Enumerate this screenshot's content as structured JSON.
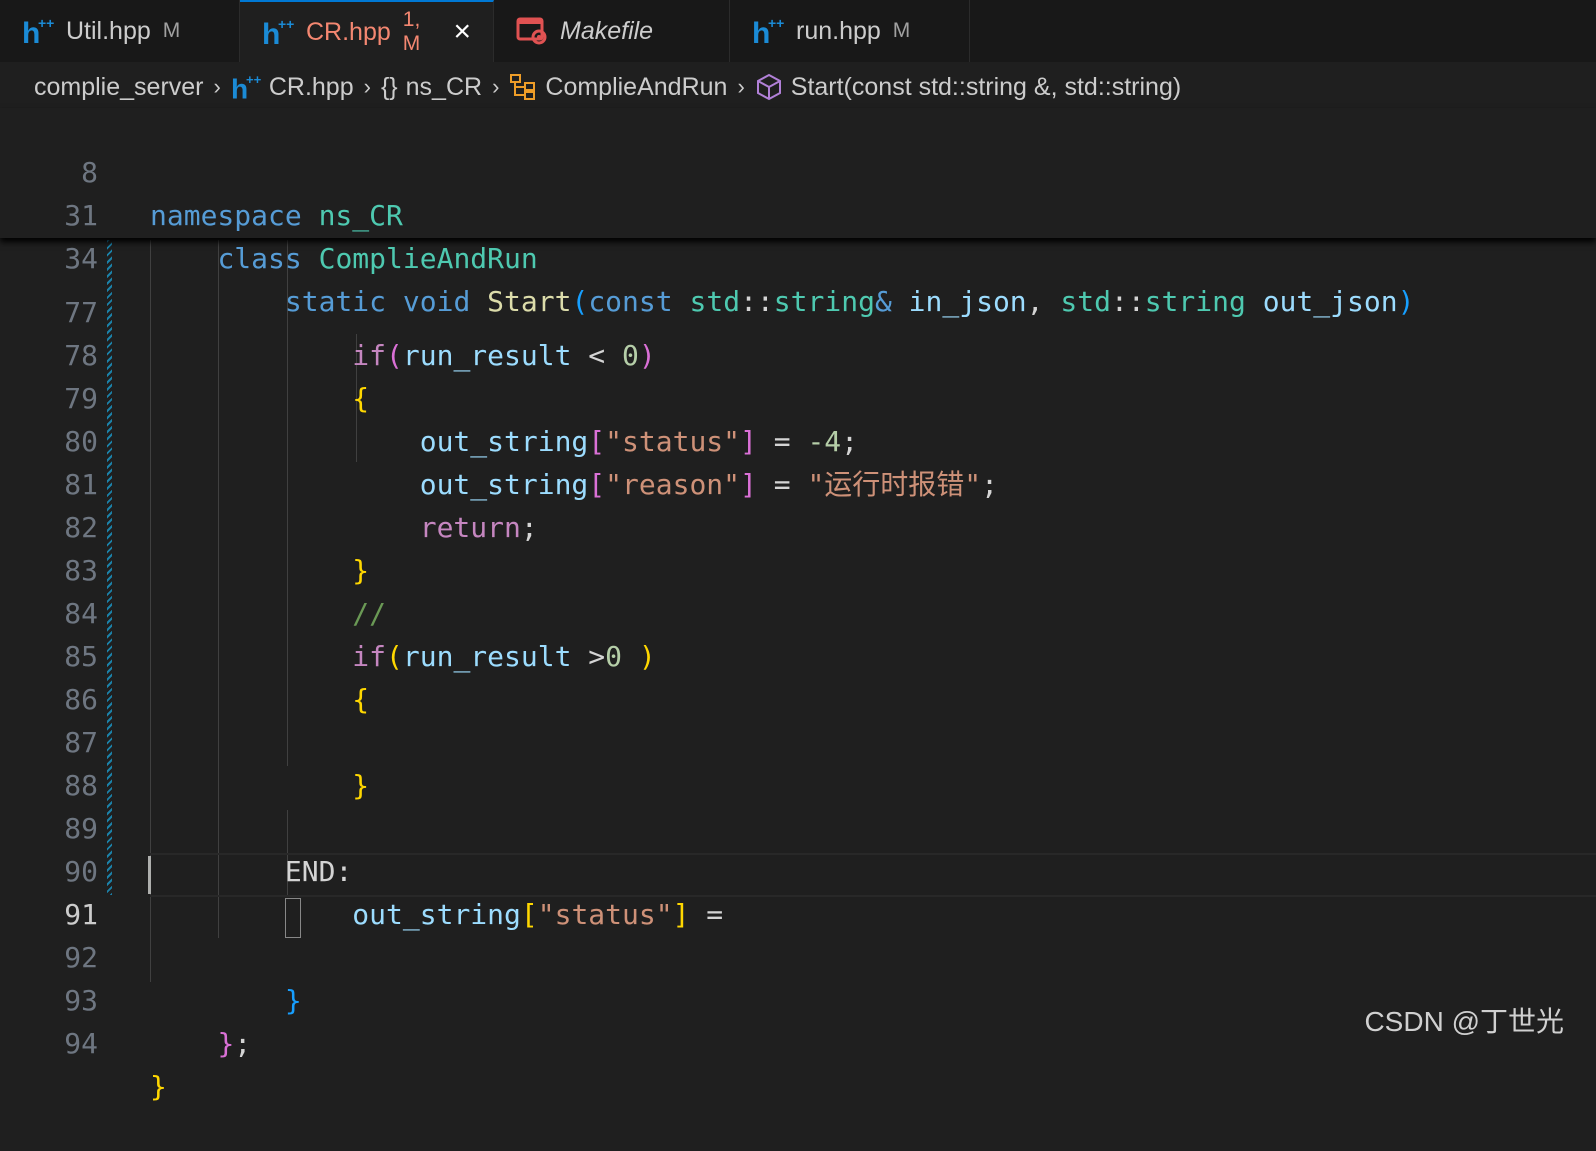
{
  "tabs": [
    {
      "label": "Util.hpp",
      "status": "M"
    },
    {
      "label": "CR.hpp",
      "status": "1, M"
    },
    {
      "label": "Makefile",
      "status": ""
    },
    {
      "label": "run.hpp",
      "status": "M"
    }
  ],
  "breadcrumb": {
    "folder": "complie_server",
    "file": "CR.hpp",
    "namespace_symbol": "{}",
    "namespace": "ns_CR",
    "class": "ComplieAndRun",
    "method": "Start(const std::string &, std::string)"
  },
  "sticky": {
    "l8": {
      "num": "8",
      "kw": "namespace",
      "name": "ns_CR"
    },
    "l31": {
      "num": "31",
      "kw": "class",
      "name": "ComplieAndRun"
    },
    "l34": {
      "num": "34",
      "static": "static",
      "void": "void",
      "fn": "Start",
      "p1": "(",
      "const": "const",
      "ns1": "std",
      "col1": "::",
      "t1": "string",
      "amp": "&",
      "a1": "in_json",
      "comma": ",",
      "ns2": "std",
      "col2": "::",
      "t2": "string",
      "a2": "out_json",
      "p2": ")"
    }
  },
  "code": {
    "l77": {
      "num": "77",
      "kw": "if",
      "p1": "(",
      "v": "run_result",
      "op": " < ",
      "n": "0",
      "p2": ")"
    },
    "l78": {
      "num": "78",
      "b": "{"
    },
    "l79": {
      "num": "79",
      "v": "out_string",
      "lb": "[",
      "s": "\"status\"",
      "rb": "]",
      "op": " = ",
      "n": "-4",
      "semi": ";"
    },
    "l80": {
      "num": "80",
      "v": "out_string",
      "lb": "[",
      "s": "\"reason\"",
      "rb": "]",
      "op": " = ",
      "s2": "\"运行时报错\"",
      "semi": ";"
    },
    "l81": {
      "num": "81",
      "kw": "return",
      "semi": ";"
    },
    "l82": {
      "num": "82",
      "b": "}"
    },
    "l83": {
      "num": "83",
      "c": "//"
    },
    "l84": {
      "num": "84",
      "kw": "if",
      "p1": "(",
      "v": "run_result",
      "op": " >",
      "n": "0",
      "sp": " ",
      "p2": ")"
    },
    "l85": {
      "num": "85",
      "b": "{"
    },
    "l86": {
      "num": "86"
    },
    "l87": {
      "num": "87",
      "b": "}"
    },
    "l88": {
      "num": "88"
    },
    "l89": {
      "num": "89",
      "label": "END",
      "colon": ":"
    },
    "l90": {
      "num": "90",
      "v": "out_string",
      "lb": "[",
      "s": "\"status\"",
      "rb": "]",
      "op": " ="
    },
    "l91": {
      "num": "91"
    },
    "l92": {
      "num": "92",
      "b": "}"
    },
    "l93": {
      "num": "93",
      "b": "}",
      "semi": ";"
    },
    "l94": {
      "num": "94",
      "b": "}"
    }
  },
  "watermark": "CSDN @丁世光"
}
